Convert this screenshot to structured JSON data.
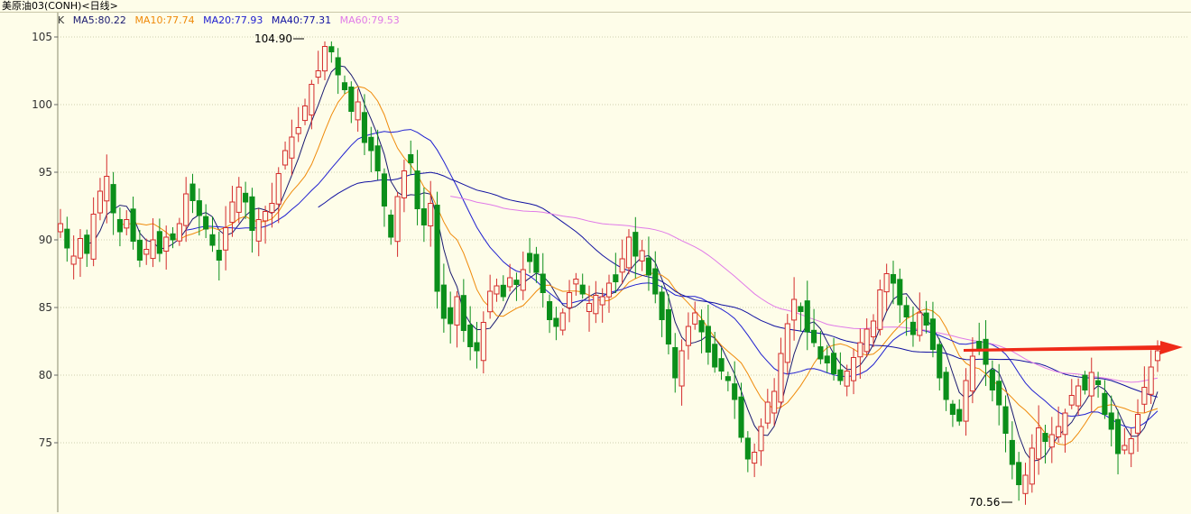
{
  "title": "美原油03(CONH)<日线>",
  "legend": {
    "k": "K",
    "ma5": "MA5:80.22",
    "ma10": "MA10:77.74",
    "ma20": "MA20:77.93",
    "ma40": "MA40:77.31",
    "ma60": "MA60:79.53"
  },
  "colors": {
    "up": "#d42c2c",
    "down": "#0b8f1a",
    "ma5": "#1a1a70",
    "ma10": "#ef8a0a",
    "ma20": "#2020d0",
    "ma40": "#1010a0",
    "ma60": "#e07ae8",
    "arrow": "#ef2a18"
  },
  "annotations": {
    "high_label": "104.90",
    "low_label": "70.56"
  },
  "chart_data": {
    "type": "candlestick",
    "y_ticks": [
      "105",
      "100",
      "95",
      "90",
      "85",
      "80",
      "75"
    ],
    "y_tick_values": [
      105,
      100,
      95,
      90,
      85,
      80,
      75
    ],
    "ylim": [
      70.0,
      106.5
    ],
    "grid": "horizontal dotted",
    "high": 104.9,
    "low": 70.56,
    "close": [
      91.2,
      89.4,
      88.8,
      90.1,
      89.0,
      91.9,
      93.6,
      94.7,
      92.0,
      90.6,
      91.5,
      89.9,
      88.5,
      89.3,
      90.0,
      89.0,
      90.2,
      90.0,
      91.2,
      93.4,
      92.9,
      91.8,
      90.8,
      89.6,
      88.5,
      90.9,
      92.8,
      93.9,
      92.8,
      90.7,
      91.5,
      92.1,
      92.7,
      94.9,
      96.6,
      97.6,
      98.3,
      99.9,
      101.5,
      102.5,
      104.3,
      103.9,
      102.2,
      101.1,
      99.5,
      100.2,
      97.2,
      96.6,
      95.1,
      92.5,
      90.2,
      93.2,
      95.1,
      95.7,
      92.3,
      91.1,
      92.7,
      86.2,
      84.2,
      83.8,
      85.8,
      83.3,
      82.1,
      81.8,
      83.9,
      86.2,
      86.6,
      85.8,
      87.2,
      86.7,
      87.8,
      88.4,
      87.6,
      86.1,
      84.1,
      83.6,
      84.6,
      86.1,
      87.1,
      86.0,
      85.3,
      85.9,
      85.8,
      86.8,
      86.9,
      88.6,
      90.2,
      88.8,
      89.2,
      87.4,
      86.0,
      84.1,
      82.3,
      79.8,
      81.8,
      83.6,
      84.6,
      83.2,
      81.7,
      80.6,
      80.3,
      79.6,
      78.2,
      75.4,
      73.8,
      74.3,
      76.2,
      78.0,
      78.8,
      81.6,
      83.8,
      85.6,
      84.7,
      83.2,
      82.4,
      81.2,
      80.9,
      80.1,
      79.6,
      80.3,
      81.3,
      82.4,
      83.4,
      84.0,
      86.3,
      87.5,
      86.8,
      85.2,
      84.3,
      83.0,
      84.6,
      83.7,
      81.9,
      79.8,
      78.2,
      77.1,
      76.6,
      79.6,
      81.4,
      81.9,
      80.8,
      78.9,
      77.8,
      75.7,
      73.4,
      71.9,
      72.6,
      74.6,
      76.1,
      75.1,
      75.6,
      76.2,
      77.2,
      78.5,
      79.2,
      78.9,
      80.2,
      79.3,
      77.1,
      76.0,
      74.2,
      74.8,
      75.3,
      77.1,
      79.1,
      80.6,
      81.8
    ],
    "ma5": [],
    "series_names": [
      "MA5",
      "MA10",
      "MA20",
      "MA40",
      "MA60"
    ]
  }
}
